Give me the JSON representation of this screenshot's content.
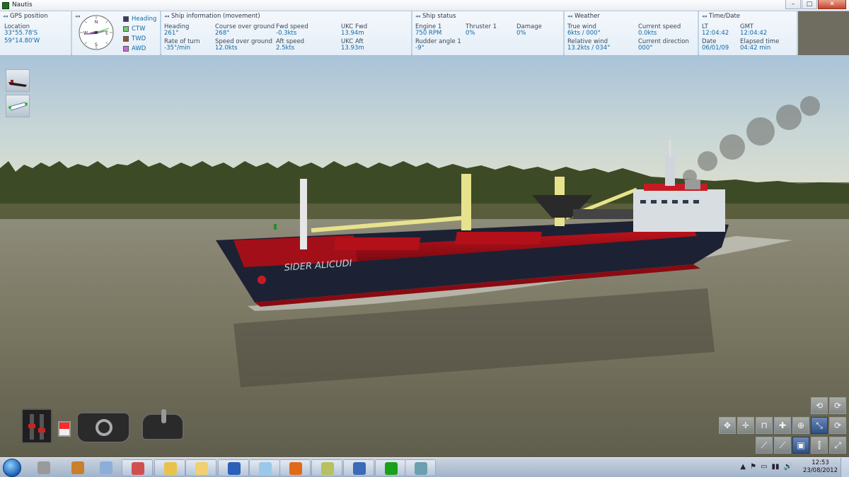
{
  "window": {
    "title": "Nautis",
    "controls": [
      "–",
      "□",
      "✕"
    ]
  },
  "gps": {
    "header": "GPS position",
    "location_label": "Location",
    "lat": "33°55.78'S",
    "lon": "59°14.80'W"
  },
  "compass": {
    "heading_deg": 261,
    "cardinals": {
      "n": "N",
      "e": "E",
      "s": "S",
      "w": "W"
    },
    "legend": [
      {
        "label": "Heading",
        "color": "#3a3a6a"
      },
      {
        "label": "CTW",
        "color": "#6bcf6b"
      },
      {
        "label": "TWD",
        "color": "#8a5a3a"
      },
      {
        "label": "AWD",
        "color": "#c96bd6"
      }
    ]
  },
  "ship_info": {
    "header": "Ship information (movement)",
    "heading_label": "Heading",
    "heading_value": "261°",
    "rot_label": "Rate of turn",
    "rot_value": "-35°/min",
    "cog_label": "Course over ground",
    "cog_value": "268°",
    "sog_label": "Speed over ground",
    "sog_value": "12.0kts",
    "fwd_label": "Fwd speed",
    "fwd_value": "-0.3kts",
    "aft_label": "Aft speed",
    "aft_value": "2.5kts",
    "ukc_fwd_label": "UKC Fwd",
    "ukc_fwd_value": "13.94m",
    "ukc_aft_label": "UKC Aft",
    "ukc_aft_value": "13.93m"
  },
  "ship_status": {
    "header": "Ship status",
    "engine_label": "Engine 1",
    "engine_value": "750 RPM",
    "thruster_label": "Thruster 1",
    "thruster_value": "0%",
    "damage_label": "Damage",
    "damage_value": "0%",
    "rudder_label": "Rudder angle 1",
    "rudder_value": "-9°"
  },
  "weather": {
    "header": "Weather",
    "true_wind_label": "True wind",
    "true_wind_value": "6kts / 000°",
    "rel_wind_label": "Relative wind",
    "rel_wind_value": "13.2kts / 034°",
    "cur_speed_label": "Current speed",
    "cur_speed_value": "0.0kts",
    "cur_dir_label": "Current direction",
    "cur_dir_value": "000°"
  },
  "time": {
    "header": "Time/Date",
    "lt_label": "LT",
    "lt_value": "12:04:42",
    "gmt_label": "GMT",
    "gmt_value": "12:04:42",
    "date_label": "Date",
    "date_value": "06/01/09",
    "elapsed_label": "Elapsed time",
    "elapsed_value": "04:42 min"
  },
  "scene": {
    "ship_name": "SIDER ALICUDI"
  },
  "camera_toolbar": {
    "row1": [
      "⟲",
      "⟳"
    ],
    "row2": [
      "✥",
      "✛",
      "⊓",
      "✚",
      "⊕",
      "⤡",
      "⟳"
    ],
    "row3": [
      "⟋",
      "⟋",
      "▣",
      "⫿",
      "⤢"
    ]
  },
  "taskbar": {
    "apps": [
      {
        "name": "settings",
        "color": "#9a9a9a"
      },
      {
        "name": "shield",
        "color": "#c8802a"
      },
      {
        "name": "calculator",
        "color": "#8ab0d8"
      },
      {
        "name": "paint",
        "color": "#d05050"
      },
      {
        "name": "explorer",
        "color": "#e8c24a"
      },
      {
        "name": "weather",
        "color": "#f0d070"
      },
      {
        "name": "word",
        "color": "#2b5fb8"
      },
      {
        "name": "notes",
        "color": "#9ac8e8"
      },
      {
        "name": "firefox",
        "color": "#e06a1a"
      },
      {
        "name": "chat",
        "color": "#b8c060"
      },
      {
        "name": "thunderbird",
        "color": "#3a6ab8"
      },
      {
        "name": "nautis",
        "color": "#1aa01a"
      },
      {
        "name": "window",
        "color": "#6aa0b0"
      }
    ],
    "tray_icons": [
      "▲",
      "⚑",
      "▭",
      "▮▮",
      "🔊"
    ],
    "clock_time": "12:53",
    "clock_date": "23/08/2012"
  }
}
